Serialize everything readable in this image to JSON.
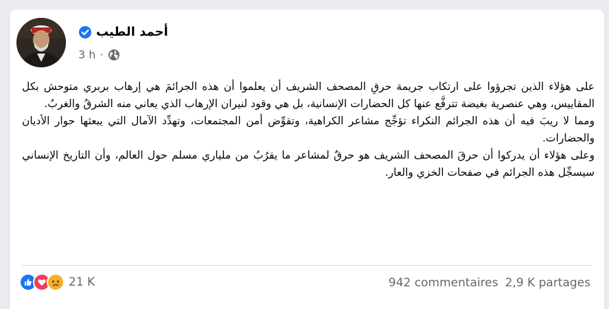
{
  "post": {
    "author": "أحمد الطيب",
    "time": "3 h",
    "separator": "·",
    "paragraphs": [
      "على هؤلاء الذين تجرؤوا على ارتكاب جريمة حرقِ المصحف الشريف أن يعلموا أن هذه الجرائمَ هي إرهاب بربري متوحش بكل المقاييس، وهي عنصرية بغيضة تترفَّع عنها كل الحضارات الإنسانية، بل هي وقود لنيران الإرهاب الذي يعاني منه الشرقُ والغربُ.",
      "ومما لا ريبَ فيه أن هذه الجرائم النكراء تؤجِّج مشاعر الكراهية، وتقوِّض أمن المجتمعات، وتهدِّد الآمال التي يبعثها حوار الأديان والحضارات.",
      "وعلى هؤلاء أن يدركوا أن حرقَ المصحف الشريف هو حرقٌ لمشاعر ما يقرُبُ من ملياري مسلم حول العالم، وأن التاريخ الإنساني سيسجِّل هذه الجرائم في صفحات الخزي والعار."
    ]
  },
  "stats": {
    "reactions_count": "21 K",
    "comments": "942 commentaires",
    "shares": "2,9 K partages"
  },
  "icons": {
    "verified": "verified-badge-icon",
    "audience": "globe-icon",
    "reactions": [
      "like-icon",
      "love-icon",
      "sad-icon"
    ]
  },
  "colors": {
    "facebook_blue": "#1877f2",
    "love_red": "#f33e58",
    "sad_yellow": "#f7b125"
  }
}
